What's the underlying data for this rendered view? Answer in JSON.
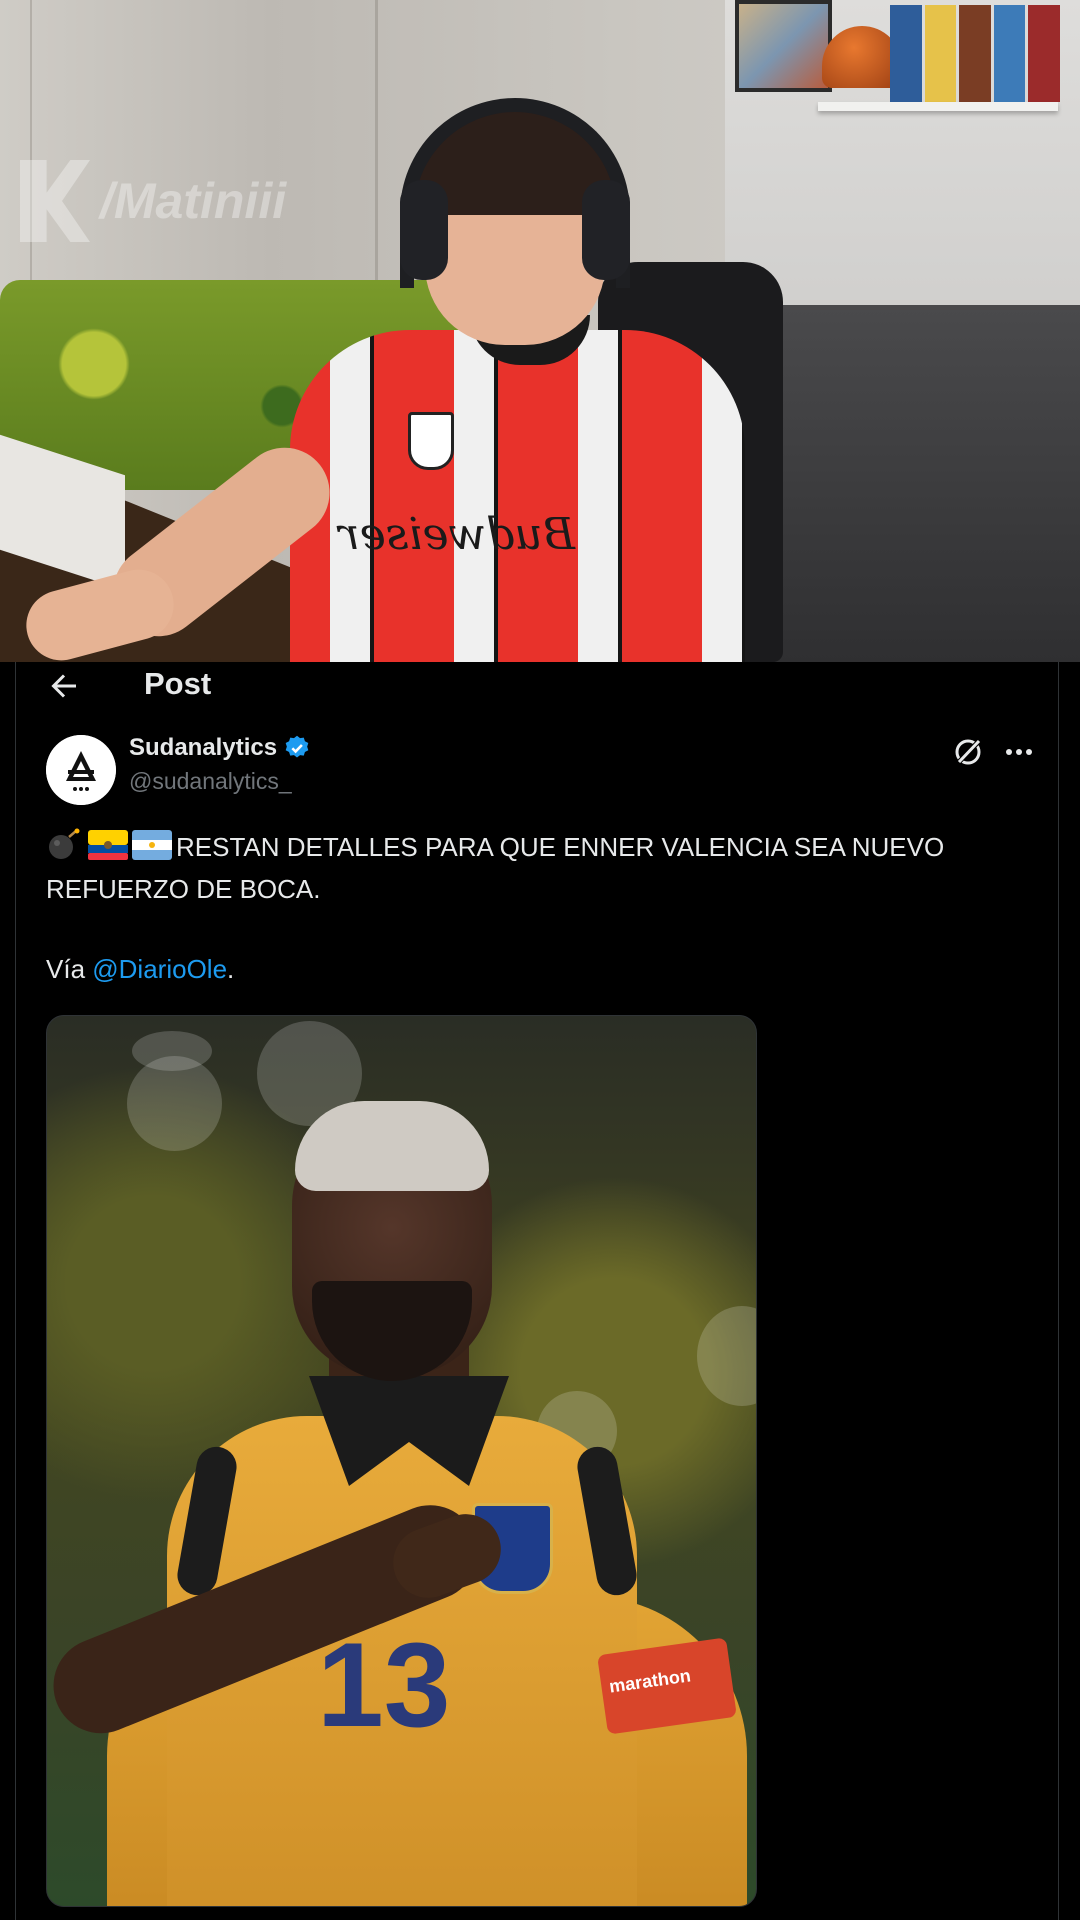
{
  "watermark": {
    "text": "/Matiniii"
  },
  "webcam": {
    "shirt_sponsor": "Budweiser"
  },
  "topbar": {
    "title": "Post"
  },
  "post": {
    "author_name": "Sudanalytics",
    "author_handle": "@sudanalytics_",
    "text_line1": "RESTAN DETALLES PARA QUE ENNER VALENCIA SEA NUEVO",
    "text_line2": "REFUERZO DE BOCA.",
    "via_prefix": "Vía",
    "via_mention": "@DiarioOle",
    "via_suffix": "."
  },
  "media": {
    "armband_text": "marathon",
    "shirt_number": "13"
  },
  "colors": {
    "accent": "#1d9bf0",
    "background": "#000000",
    "text": "#e7e9ea",
    "secondary": "#71767b"
  },
  "icons": [
    "back-arrow-icon",
    "verified-badge-icon",
    "grok-icon",
    "more-options-icon",
    "bomb-emoji",
    "ecuador-flag-emoji",
    "argentina-flag-emoji"
  ]
}
